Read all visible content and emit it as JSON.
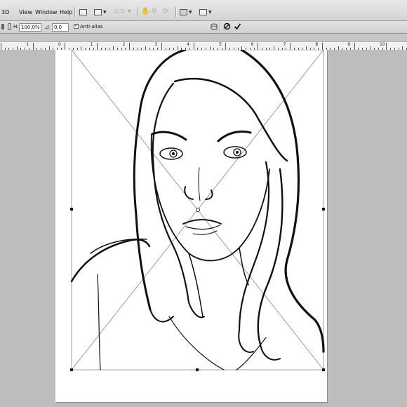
{
  "menu": {
    "items": [
      "3D",
      "View",
      "Window",
      "Help"
    ]
  },
  "options": {
    "width_value": "100,0%",
    "angle_value": "0,0",
    "antialias_label": "Anti-alias",
    "width_label": "H:"
  },
  "ruler": {
    "labels": [
      "1",
      "0",
      "1",
      "2",
      "3",
      "4",
      "5",
      "6",
      "7",
      "8",
      "9",
      "10",
      "11"
    ]
  },
  "icons": {
    "cancel": "cancel-transform-icon",
    "commit": "commit-transform-icon",
    "warp": "warp-icon"
  }
}
